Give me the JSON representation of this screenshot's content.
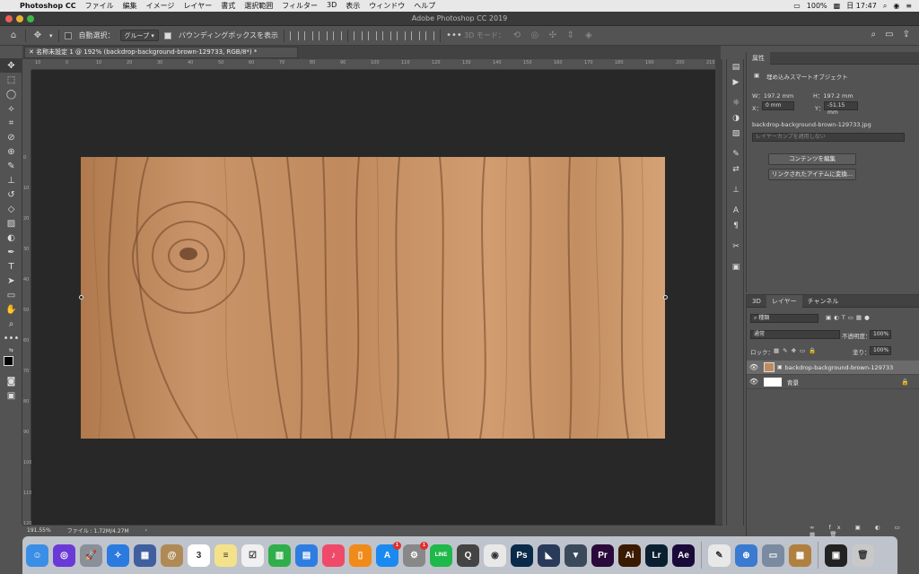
{
  "menubar": {
    "app_name": "Photoshop CC",
    "items": [
      "ファイル",
      "編集",
      "イメージ",
      "レイヤー",
      "書式",
      "選択範囲",
      "フィルター",
      "3D",
      "表示",
      "ウィンドウ",
      "ヘルプ"
    ],
    "battery": "100%",
    "time": "日 17:47"
  },
  "window": {
    "title": "Adobe Photoshop CC 2019"
  },
  "options_bar": {
    "auto_select_label": "自動選択：",
    "auto_select_value": "グループ",
    "bounding_box_label": "バウンディングボックスを表示",
    "mode_3d_label": "3D モード："
  },
  "document": {
    "tab_title": "名称未設定 1 @ 192% (backdrop-background-brown-129733, RGB/8*) *",
    "zoom": "191.55%",
    "file_info": "ファイル : 1.72M/4.27M"
  },
  "ruler_h": [
    "10",
    "0",
    "10",
    "20",
    "30",
    "40",
    "50",
    "60",
    "70",
    "80",
    "90",
    "100",
    "110",
    "120",
    "130",
    "140",
    "150",
    "160",
    "170",
    "180",
    "190",
    "200",
    "210"
  ],
  "ruler_v": [
    "0",
    "10",
    "20",
    "30",
    "40",
    "50",
    "60",
    "70",
    "80",
    "90",
    "100",
    "110",
    "120"
  ],
  "properties": {
    "tab": "属性",
    "type_label": "埋め込みスマートオブジェクト",
    "w_label": "W：197.2 mm",
    "h_label": "H：197.2 mm",
    "x_label": "X：",
    "x_value": "0 mm",
    "y_label": "Y：",
    "y_value": "-51.15 mm",
    "filename": "backdrop-background-brown-129733.jpg",
    "comp_placeholder": "レイヤーカンプを適用しない",
    "edit_contents": "コンテンツを編集",
    "convert_linked": "リンクされたアイテムに変換..."
  },
  "layers_panel": {
    "tabs": [
      "3D",
      "レイヤー",
      "チャンネル"
    ],
    "filter_kind": "種類",
    "blend_mode": "通常",
    "opacity_label": "不透明度：",
    "opacity_value": "100%",
    "lock_label": "ロック：",
    "fill_label": "塗り：",
    "fill_value": "100%",
    "layers": [
      {
        "name": "backdrop-background-brown-129733",
        "selected": true
      },
      {
        "name": "背景",
        "selected": false
      }
    ]
  },
  "dock": {
    "apps": [
      {
        "name": "Finder",
        "color": "#3a8ee6",
        "label": "☺"
      },
      {
        "name": "Siri",
        "color": "#6a3ad6",
        "label": "◎"
      },
      {
        "name": "Launchpad",
        "color": "#8a8f98",
        "label": "🚀"
      },
      {
        "name": "Safari",
        "color": "#2a7ae0",
        "label": "✧"
      },
      {
        "name": "Preview",
        "color": "#3f5f9f",
        "label": "▦"
      },
      {
        "name": "Contacts",
        "color": "#b08a55",
        "label": "@"
      },
      {
        "name": "Calendar",
        "color": "#ffffff",
        "label": "3"
      },
      {
        "name": "Notes",
        "color": "#f3e28a",
        "label": "≡"
      },
      {
        "name": "Reminders",
        "color": "#f0f0f0",
        "label": "☑"
      },
      {
        "name": "Numbers",
        "color": "#2fae4a",
        "label": "▥"
      },
      {
        "name": "Keynote",
        "color": "#2f7de0",
        "label": "▤"
      },
      {
        "name": "Music",
        "color": "#f04a6a",
        "label": "♪"
      },
      {
        "name": "Books",
        "color": "#f08a1a",
        "label": "▯"
      },
      {
        "name": "App Store",
        "color": "#1a8af0",
        "label": "A"
      },
      {
        "name": "System Preferences",
        "color": "#888888",
        "label": "⚙"
      },
      {
        "name": "LINE",
        "color": "#1fb84a",
        "label": "LINE"
      },
      {
        "name": "QuickTime",
        "color": "#444444",
        "label": "Q"
      },
      {
        "name": "Chrome",
        "color": "#e8e8e8",
        "label": "◉"
      },
      {
        "name": "Photoshop",
        "color": "#0a2a4a",
        "label": "Ps"
      },
      {
        "name": "Brackets",
        "color": "#2a3a5a",
        "label": "◣"
      },
      {
        "name": "Camera Raw",
        "color": "#3a4a5a",
        "label": "▼"
      },
      {
        "name": "Premiere Pro",
        "color": "#2a0a3a",
        "label": "Pr"
      },
      {
        "name": "Illustrator",
        "color": "#3a1a00",
        "label": "Ai"
      },
      {
        "name": "Lightroom",
        "color": "#0a2030",
        "label": "Lr"
      },
      {
        "name": "After Effects",
        "color": "#1a0a3a",
        "label": "Ae"
      },
      {
        "name": "Script Editor",
        "color": "#e8e8e8",
        "label": "✎"
      },
      {
        "name": "Network",
        "color": "#3a7ad0",
        "label": "⊕"
      },
      {
        "name": "Image Capture",
        "color": "#7a8aa0",
        "label": "▭"
      },
      {
        "name": "Archive",
        "color": "#b08040",
        "label": "▦"
      },
      {
        "name": "Console",
        "color": "#222222",
        "label": "▣"
      },
      {
        "name": "Trash",
        "color": "#c8c8c8",
        "label": "🗑"
      }
    ],
    "badges": {
      "App Store": "1",
      "System Preferences": "1"
    }
  },
  "colors": {
    "ui_dark": "#535353",
    "pasteboard": "#282828",
    "wood": "#c08a5e",
    "menubar": "#e8e8e8"
  }
}
